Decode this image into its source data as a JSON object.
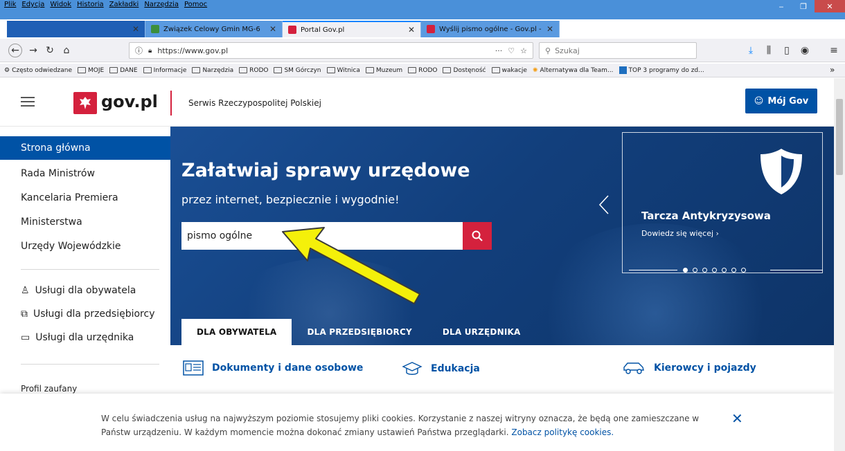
{
  "browser": {
    "menu": [
      "Plik",
      "Edycja",
      "Widok",
      "Historia",
      "Zakładki",
      "Narzędzia",
      "Pomoc"
    ],
    "tabs": [
      {
        "title": "",
        "blurred": true
      },
      {
        "title": "Związek Celowy Gmin MG-6"
      },
      {
        "title": "Portal Gov.pl",
        "active": true
      },
      {
        "title": "Wyślij pismo ogólne - Gov.pl -"
      }
    ],
    "new_tab": "+",
    "url": "https://www.gov.pl",
    "search_placeholder": "Szukaj",
    "url_more": "···",
    "bookmarks": [
      "Często odwiedzane",
      "MOJE",
      "DANE",
      "Informacje",
      "Narzędzia",
      "RODO",
      "SM Górczyn",
      "Witnica",
      "Muzeum",
      "RODO",
      "Dostęność",
      "wakacje",
      "Alternatywa dla Team...",
      "TOP 3 programy do zd..."
    ],
    "overflow": "»"
  },
  "header": {
    "logo": "gov.pl",
    "service": "Serwis Rzeczypospolitej Polskiej",
    "account_button": "Mój Gov"
  },
  "sidebar": {
    "items": [
      "Strona główna",
      "Rada Ministrów",
      "Kancelaria Premiera",
      "Ministerstwa",
      "Urzędy Wojewódzkie"
    ],
    "services": [
      "Usługi dla obywatela",
      "Usługi dla przedsiębiorcy",
      "Usługi dla urzędnika"
    ],
    "footer_item": "Profil zaufany"
  },
  "hero": {
    "title": "Załatwiaj sprawy urzędowe",
    "subtitle": "przez internet, bezpiecznie i wygodnie!",
    "search_value": "pismo ogólne",
    "promo_title": "Tarcza Antykryzysowa",
    "promo_link": "Dowiedz się więcej ›",
    "slides_total": 7,
    "slide_active": 1,
    "tabs": [
      "DLA OBYWATELA",
      "DLA PRZEDSIĘBIORCY",
      "DLA URZĘDNIKA"
    ]
  },
  "categories": [
    "Dokumenty i dane osobowe",
    "Edukacja",
    "Kierowcy i pojazdy"
  ],
  "cookie": {
    "text": "W celu świadczenia usług na najwyższym poziomie stosujemy pliki cookies. Korzystanie z naszej witryny oznacza, że będą one zamieszczane w Państw urządzeniu. W każdym momencie można dokonać zmiany ustawień Państwa przeglądarki.",
    "link": "Zobacz politykę cookies."
  },
  "colors": {
    "brand_blue": "#0052a5",
    "brand_red": "#d4213d",
    "annotation_arrow": "#f4f00a"
  }
}
